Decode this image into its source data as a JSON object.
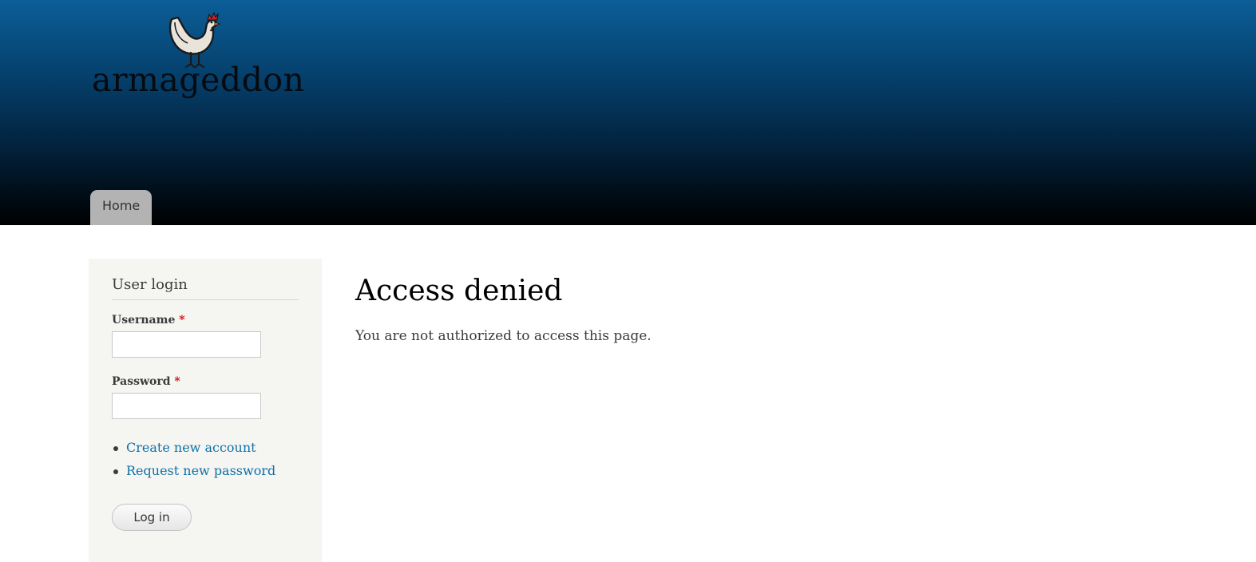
{
  "site": {
    "name": "armageddon",
    "logo_icon": "rooster-icon"
  },
  "nav": {
    "tabs": [
      {
        "label": "Home",
        "active": true
      }
    ]
  },
  "sidebar": {
    "title": "User login",
    "username": {
      "label": "Username",
      "required_mark": "*",
      "value": ""
    },
    "password": {
      "label": "Password",
      "required_mark": "*",
      "value": ""
    },
    "links": [
      {
        "label": "Create new account"
      },
      {
        "label": "Request new password"
      }
    ],
    "submit_label": "Log in"
  },
  "main": {
    "title": "Access denied",
    "message": "You are not authorized to access this page."
  },
  "colors": {
    "header_top": "#0b5e98",
    "header_bottom": "#000000",
    "link": "#0f71a7",
    "required": "#e00000",
    "sidebar_bg": "#f5f5f2",
    "tab_bg": "#b3b3b3"
  }
}
